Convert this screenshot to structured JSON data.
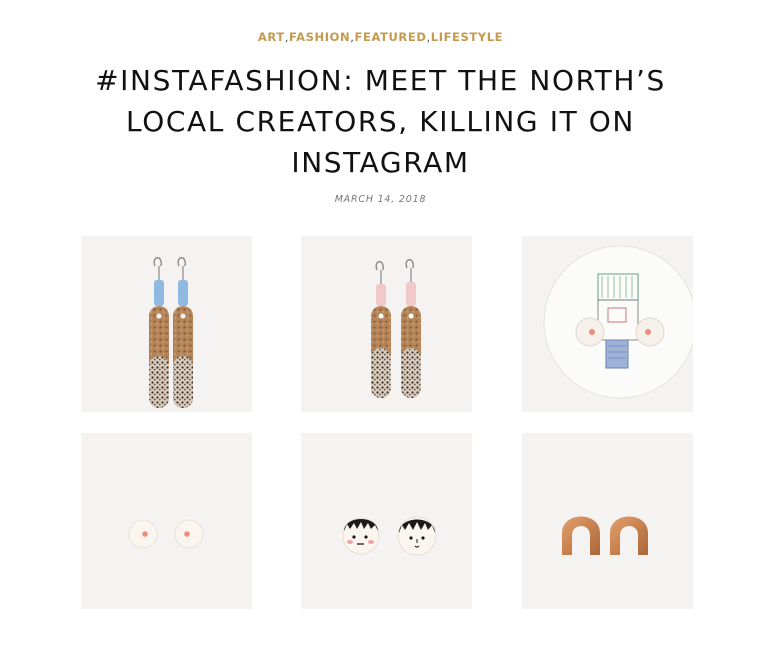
{
  "post": {
    "categories": [
      {
        "label": "ART"
      },
      {
        "label": "FASHION"
      },
      {
        "label": "FEATURED"
      },
      {
        "label": "LIFESTYLE"
      }
    ],
    "separator": ",",
    "title_lines": [
      "#INSTAFASHION: MEET THE NORTH’S",
      "LOCAL CREATORS, KILLING IT ON",
      "INSTAGRAM"
    ],
    "date": "MARCH 14, 2018"
  },
  "gallery": {
    "images": [
      {
        "subject": "blue-bead-speckled-drop-earrings"
      },
      {
        "subject": "pink-bead-speckled-drop-earrings"
      },
      {
        "subject": "stud-earrings-on-illustrated-card"
      },
      {
        "subject": "white-dot-stud-earrings"
      },
      {
        "subject": "face-stud-earrings"
      },
      {
        "subject": "copper-arch-stud-earrings"
      }
    ]
  },
  "colors": {
    "category_accent": "#c39a4e",
    "title": "#111111",
    "date": "#777777",
    "tile_background": "#f4f3f2"
  }
}
